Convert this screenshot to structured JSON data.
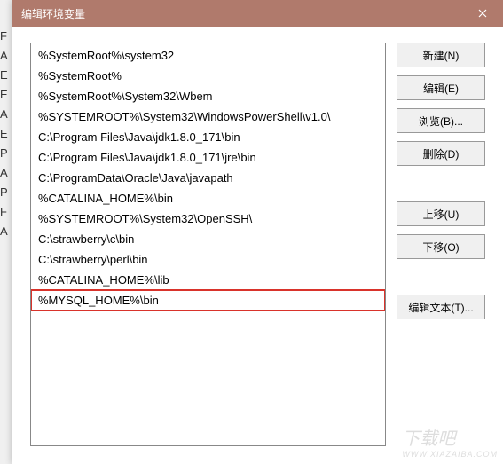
{
  "window": {
    "title": "编辑环境变量"
  },
  "list": {
    "items": [
      "%SystemRoot%\\system32",
      "%SystemRoot%",
      "%SystemRoot%\\System32\\Wbem",
      "%SYSTEMROOT%\\System32\\WindowsPowerShell\\v1.0\\",
      "C:\\Program Files\\Java\\jdk1.8.0_171\\bin",
      "C:\\Program Files\\Java\\jdk1.8.0_171\\jre\\bin",
      "C:\\ProgramData\\Oracle\\Java\\javapath",
      "%CATALINA_HOME%\\bin",
      "%SYSTEMROOT%\\System32\\OpenSSH\\",
      "C:\\strawberry\\c\\bin",
      "C:\\strawberry\\perl\\bin",
      "%CATALINA_HOME%\\lib",
      "%MYSQL_HOME%\\bin"
    ],
    "highlighted_index": 12
  },
  "buttons": {
    "new": "新建(N)",
    "edit": "编辑(E)",
    "browse": "浏览(B)...",
    "delete": "删除(D)",
    "moveup": "上移(U)",
    "movedown": "下移(O)",
    "edittext": "编辑文本(T)..."
  },
  "watermark": {
    "main": "下载吧",
    "sub": "WWW.XIAZAIBA.COM"
  },
  "outer_hint_chars": [
    "F",
    "A",
    "E",
    "E",
    "A",
    "E",
    "P",
    "A",
    "P",
    "F",
    "A"
  ]
}
